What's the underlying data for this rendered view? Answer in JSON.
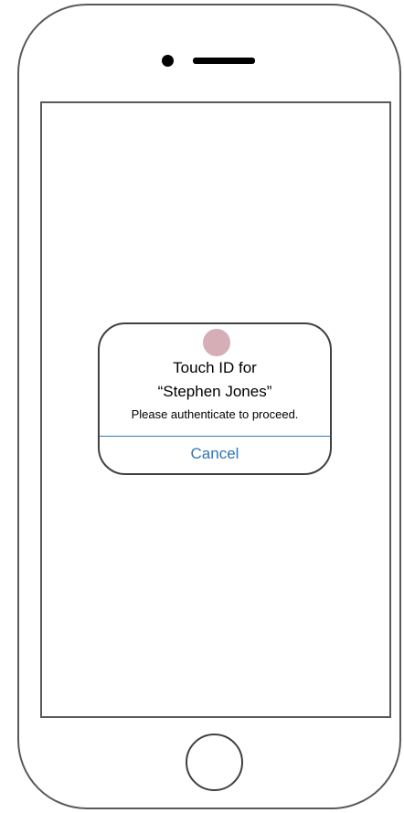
{
  "touch_id_dialog": {
    "title_line_1": "Touch ID for",
    "title_line_2": "“Stephen Jones”",
    "message": "Please authenticate to proceed.",
    "cancel_label": "Cancel",
    "fingerprint_icon": "fingerprint-icon"
  },
  "colors": {
    "accent": "#2e75b6",
    "fingerprint": "#d6aeb5",
    "frame": "#595959"
  }
}
